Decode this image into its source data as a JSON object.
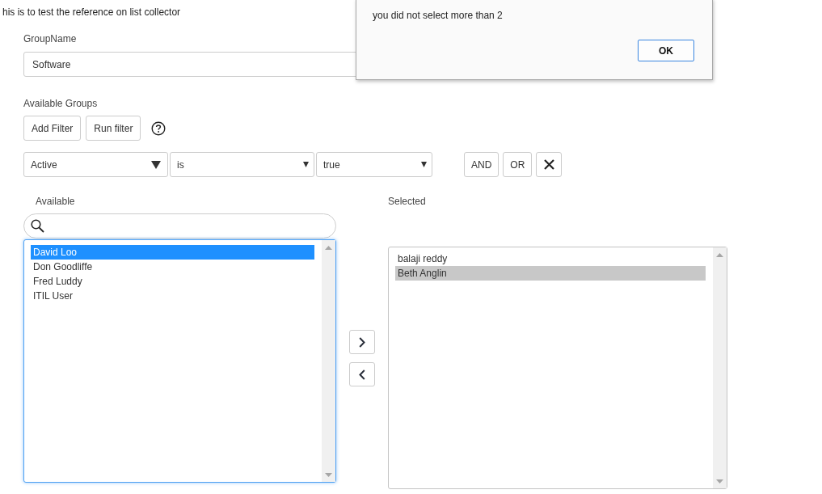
{
  "heading": "his is to test the reference on list collector",
  "group_name": {
    "label": "GroupName",
    "value": "Software"
  },
  "available_groups": {
    "label": "Available Groups",
    "buttons": [
      "Add Filter",
      "Run filter"
    ],
    "filter": {
      "dropdowns": [
        {
          "kind": "field",
          "value": "Active"
        },
        {
          "kind": "operator",
          "value": "is"
        },
        {
          "kind": "value",
          "value": "true"
        }
      ],
      "buttons": [
        "AND",
        "OR"
      ]
    }
  },
  "collector": {
    "available": {
      "label": "Available",
      "focused": true,
      "items": [
        {
          "label": "David Loo",
          "selected": true
        },
        {
          "label": "Don Goodliffe",
          "selected": false
        },
        {
          "label": "Fred Luddy",
          "selected": false
        },
        {
          "label": "ITIL User",
          "selected": false
        }
      ]
    },
    "selected": {
      "label": "Selected",
      "focused": false,
      "items": [
        {
          "label": "balaji reddy",
          "selected": false
        },
        {
          "label": "Beth Anglin",
          "selected": true
        }
      ]
    }
  },
  "alert": {
    "message": "you did not select more than 2",
    "button": "OK"
  }
}
